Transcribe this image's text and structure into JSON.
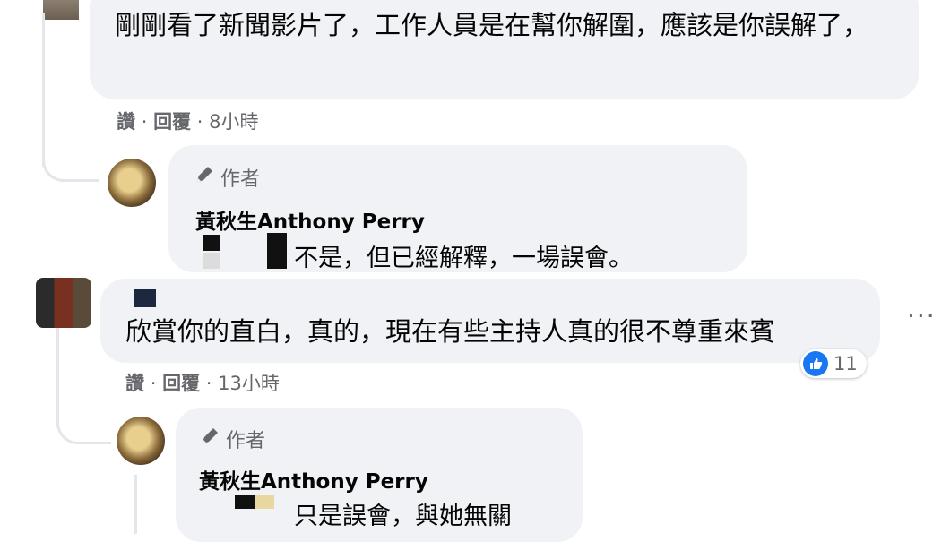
{
  "comments": [
    {
      "text": "剛剛看了新聞影片了，工作人員是在幫你解圍，應該是你誤解了，",
      "actions": {
        "like": "讚",
        "reply": "回覆",
        "time": "8小時"
      },
      "reply": {
        "badge": "作者",
        "author": "黃秋生Anthony Perry",
        "text": "不是，但已經解釋，一場誤會。"
      }
    },
    {
      "text": "欣賞你的直白，真的，現在有些主持人真的很不尊重來賓",
      "actions": {
        "like": "讚",
        "reply": "回覆",
        "time": "13小時"
      },
      "reaction_count": "11",
      "more": "···",
      "reply": {
        "badge": "作者",
        "author": "黃秋生Anthony Perry",
        "text": "只是誤會，與她無關"
      }
    }
  ],
  "sep": "·"
}
